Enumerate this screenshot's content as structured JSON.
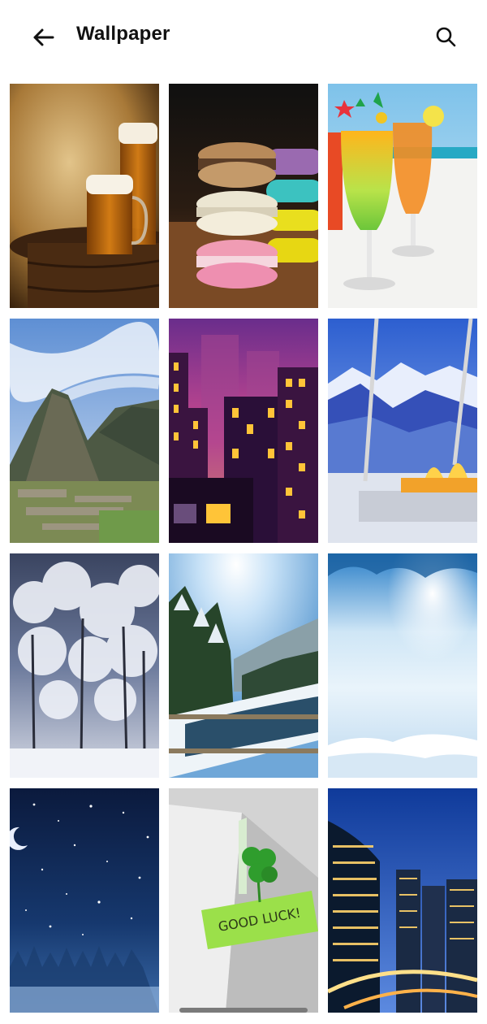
{
  "header": {
    "title": "Wallpaper",
    "back_icon": "arrow-left-icon",
    "search_icon": "search-icon"
  },
  "wallpapers": [
    {
      "id": "beer-mugs",
      "note_text": ""
    },
    {
      "id": "macarons",
      "note_text": ""
    },
    {
      "id": "cocktails-beach",
      "note_text": ""
    },
    {
      "id": "machu-picchu",
      "note_text": ""
    },
    {
      "id": "night-city",
      "note_text": ""
    },
    {
      "id": "mountain-fireplace",
      "note_text": ""
    },
    {
      "id": "snowy-forest",
      "note_text": ""
    },
    {
      "id": "winter-river",
      "note_text": ""
    },
    {
      "id": "snow-field",
      "note_text": ""
    },
    {
      "id": "starry-night",
      "note_text": ""
    },
    {
      "id": "good-luck-clover",
      "note_text": "GOOD LUCK!"
    },
    {
      "id": "city-skyline",
      "note_text": ""
    }
  ],
  "colors": {
    "text": "#111111",
    "background": "#ffffff"
  }
}
